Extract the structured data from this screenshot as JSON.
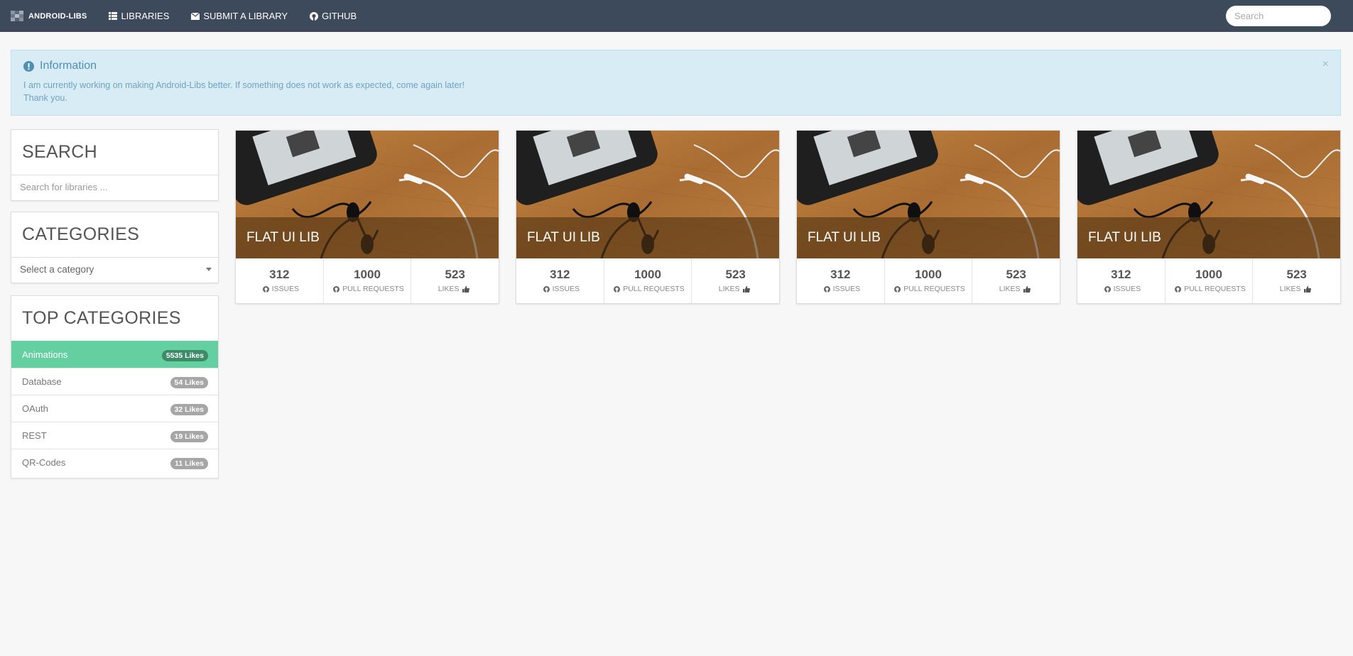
{
  "nav": {
    "brand": "ANDROID-LIBS",
    "links": [
      {
        "label": "LIBRARIES",
        "icon": "list-icon"
      },
      {
        "label": "SUBMIT A LIBRARY",
        "icon": "envelope-icon"
      },
      {
        "label": "GITHUB",
        "icon": "github-icon"
      }
    ],
    "search_placeholder": "Search"
  },
  "alert": {
    "title": "Information",
    "icon": "exclamation-circle-icon",
    "line1": "I am currently working on making Android-Libs better. If something does not work as expected, come again later!",
    "line2": "Thank you.",
    "close": "×"
  },
  "sidebar": {
    "search": {
      "title": "SEARCH",
      "placeholder": "Search for libraries ..."
    },
    "categories": {
      "title": "CATEGORIES",
      "selected": "Select a category"
    },
    "top_categories": {
      "title": "TOP CATEGORIES",
      "items": [
        {
          "label": "Animations",
          "badge": "5535 Likes",
          "active": true
        },
        {
          "label": "Database",
          "badge": "54 Likes"
        },
        {
          "label": "OAuth",
          "badge": "32 Likes"
        },
        {
          "label": "REST",
          "badge": "19 Likes"
        },
        {
          "label": "QR-Codes",
          "badge": "11 Likes"
        }
      ]
    }
  },
  "cards": [
    {
      "title": "FLAT UI LIB",
      "issues": "312",
      "issues_label": "ISSUES",
      "pulls": "1000",
      "pulls_label": "PULL REQUESTS",
      "likes": "523",
      "likes_label": "LIKES"
    },
    {
      "title": "FLAT UI LIB",
      "issues": "312",
      "issues_label": "ISSUES",
      "pulls": "1000",
      "pulls_label": "PULL REQUESTS",
      "likes": "523",
      "likes_label": "LIKES"
    },
    {
      "title": "FLAT UI LIB",
      "issues": "312",
      "issues_label": "ISSUES",
      "pulls": "1000",
      "pulls_label": "PULL REQUESTS",
      "likes": "523",
      "likes_label": "LIKES"
    },
    {
      "title": "FLAT UI LIB",
      "issues": "312",
      "issues_label": "ISSUES",
      "pulls": "1000",
      "pulls_label": "PULL REQUESTS",
      "likes": "523",
      "likes_label": "LIKES"
    }
  ],
  "colors": {
    "navbar": "#3d4a5c",
    "alert_bg": "#d8ecf5",
    "active_category": "#64d0a1"
  }
}
